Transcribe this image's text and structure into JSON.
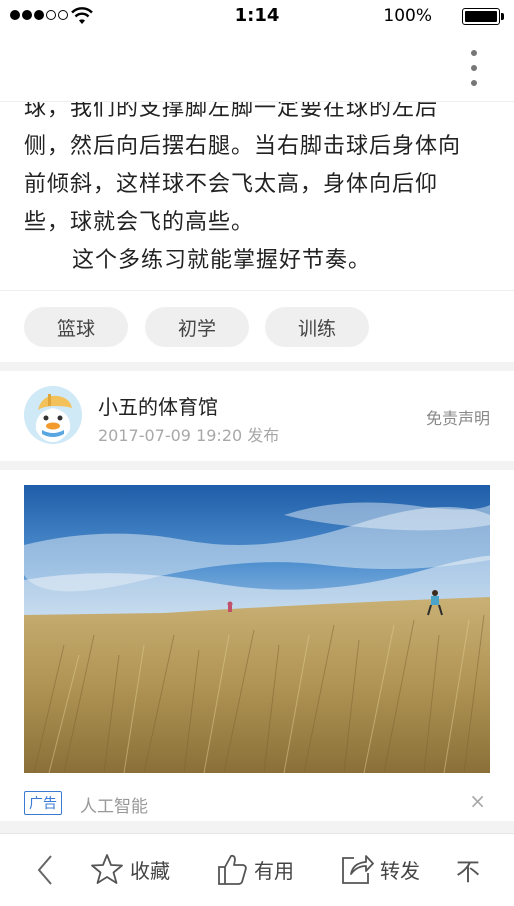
{
  "status_bar": {
    "time": "1:14",
    "battery_percent": "100%"
  },
  "article": {
    "lines": [
      "球，我们的支撑脚左脚一定要在球的左后",
      "侧，然后向后摆右腿。当右脚击球后身体向",
      "前倾斜，这样球不会飞太高，身体向后仰",
      "些，球就会飞的高些。",
      "这个多练习就能掌握好节奏。"
    ]
  },
  "tags": [
    "篮球",
    "初学",
    "训练"
  ],
  "author": {
    "name": "小五的体育馆",
    "publish_time": "2017-07-09 19:20 发布",
    "disclaimer": "免责声明"
  },
  "ad": {
    "badge": "广告",
    "source": "人工智能",
    "close": "×"
  },
  "bottom_bar": {
    "favorite": "收藏",
    "useful": "有用",
    "share": "转发",
    "dislike": "不"
  },
  "colors": {
    "accent": "#3b7bd4",
    "tag_bg": "#efefef",
    "muted": "#a8a8a8"
  }
}
